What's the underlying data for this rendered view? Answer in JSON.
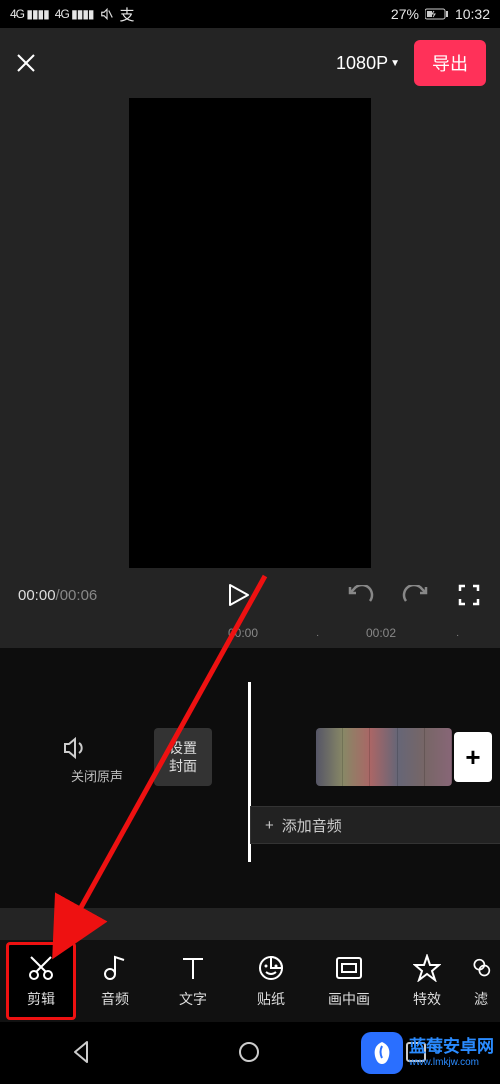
{
  "status": {
    "network1": "4G",
    "network2": "4G",
    "battery_pct": "27%",
    "time": "10:32"
  },
  "topbar": {
    "close_icon": "close-icon",
    "resolution": "1080P",
    "export_label": "导出"
  },
  "controls": {
    "current_time": "00:00",
    "total_time": "00:06"
  },
  "ruler": {
    "tick0": "00:00",
    "tick1": "00:02"
  },
  "timeline": {
    "mute_label": "关闭原声",
    "cover_line1": "设置",
    "cover_line2": "封面",
    "add_audio": "添加音频",
    "add_clip": "+"
  },
  "tools": [
    {
      "label": "剪辑",
      "icon": "scissors-icon"
    },
    {
      "label": "音频",
      "icon": "music-icon"
    },
    {
      "label": "文字",
      "icon": "text-icon"
    },
    {
      "label": "贴纸",
      "icon": "sticker-icon"
    },
    {
      "label": "画中画",
      "icon": "pip-icon"
    },
    {
      "label": "特效",
      "icon": "effects-icon"
    },
    {
      "label": "滤",
      "icon": "filter-icon"
    }
  ],
  "watermark": {
    "line1": "蓝莓安卓网",
    "line2": "www.lmkjw.com"
  }
}
